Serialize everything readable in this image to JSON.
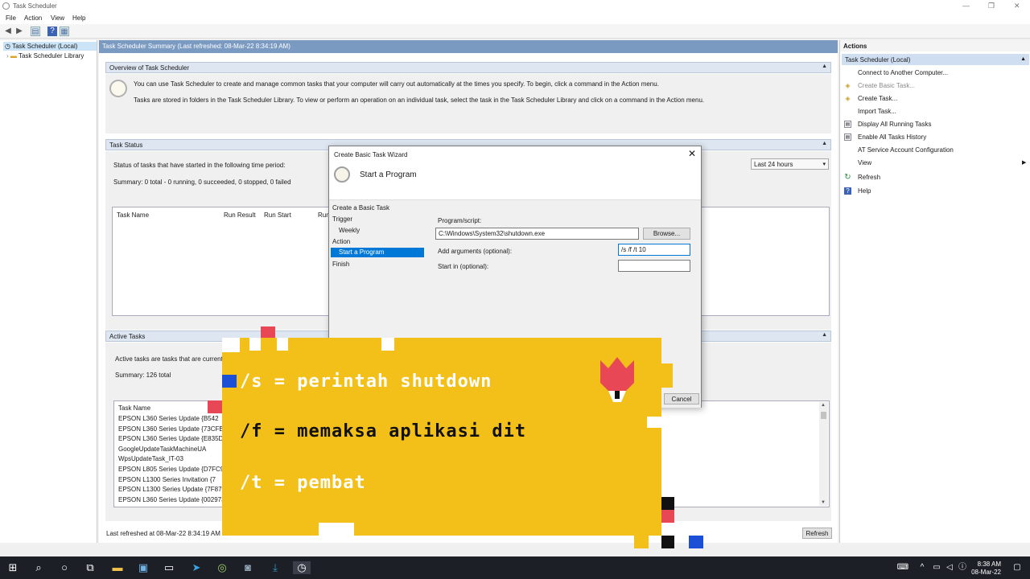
{
  "window": {
    "title": "Task Scheduler"
  },
  "menu": [
    "File",
    "Action",
    "View",
    "Help"
  ],
  "tree": {
    "root": "Task Scheduler (Local)",
    "library": "Task Scheduler Library"
  },
  "summary": {
    "header": "Task Scheduler Summary (Last refreshed: 08-Mar-22 8:34:19 AM)",
    "overview_title": "Overview of Task Scheduler",
    "overview_line1": "You can use Task Scheduler to create and manage common tasks that your computer will carry out automatically at the times you specify. To begin, click a command in the Action menu.",
    "overview_line2": "Tasks are stored in folders in the Task Scheduler Library. To view or perform an operation on an individual task, select the task in the Task Scheduler Library and click on a command in the Action menu.",
    "status_title": "Task Status",
    "status_text": "Status of tasks that have started in the following time period:",
    "status_summary": "Summary: 0 total - 0 running, 0 succeeded, 0 stopped, 0 failed",
    "period": "Last 24 hours",
    "status_columns": [
      "Task Name",
      "Run Result",
      "Run Start",
      "Run"
    ],
    "active_title": "Active Tasks",
    "active_text": "Active tasks are tasks that are currently",
    "active_summary": "Summary: 126 total",
    "active_column": "Task Name",
    "active_rows": [
      "EPSON L360 Series Update {B542",
      "EPSON L360 Series Update {73CFB...",
      "EPSON L360 Series Update {E835DE...",
      "GoogleUpdateTaskMachineUA",
      "WpsUpdateTask_IT-03",
      "EPSON L805 Series Update {D7FC9...",
      "EPSON L1300 Series Invitation {7",
      "EPSON L1300 Series Update {7F870...",
      "EPSON L360 Series Update {002973..."
    ],
    "footer": "Last refreshed at 08-Mar-22 8:34:19 AM",
    "refresh": "Refresh"
  },
  "actions": {
    "header": "Actions",
    "section": "Task Scheduler (Local)",
    "items": [
      "Connect to Another Computer...",
      "Create Basic Task...",
      "Create Task...",
      "Import Task...",
      "Display All Running Tasks",
      "Enable All Tasks History",
      "AT Service Account Configuration",
      "View",
      "Refresh",
      "Help"
    ]
  },
  "dialog": {
    "title": "Create Basic Task Wizard",
    "heading": "Start a Program",
    "steps": [
      "Create a Basic Task",
      "Trigger",
      "Weekly",
      "Action",
      "Start a Program",
      "Finish"
    ],
    "program_label": "Program/script:",
    "program_value": "C:\\Windows\\System32\\shutdown.exe",
    "browse": "Browse...",
    "args_label": "Add arguments (optional):",
    "args_value": "/s /f /t 10",
    "startin_label": "Start in (optional):",
    "startin_value": "",
    "cancel": "Cancel"
  },
  "overlay": {
    "line1": "/s = perintah shutdown",
    "line2": "/f = memaksa aplikasi dit",
    "line3": "/t = pembat"
  },
  "taskbar": {
    "time": "8:38 AM",
    "date": "08-Mar-22"
  },
  "colors": {
    "accent": "#0078d7",
    "overlay": "#f3c01a",
    "header": "#7b9ac2"
  }
}
